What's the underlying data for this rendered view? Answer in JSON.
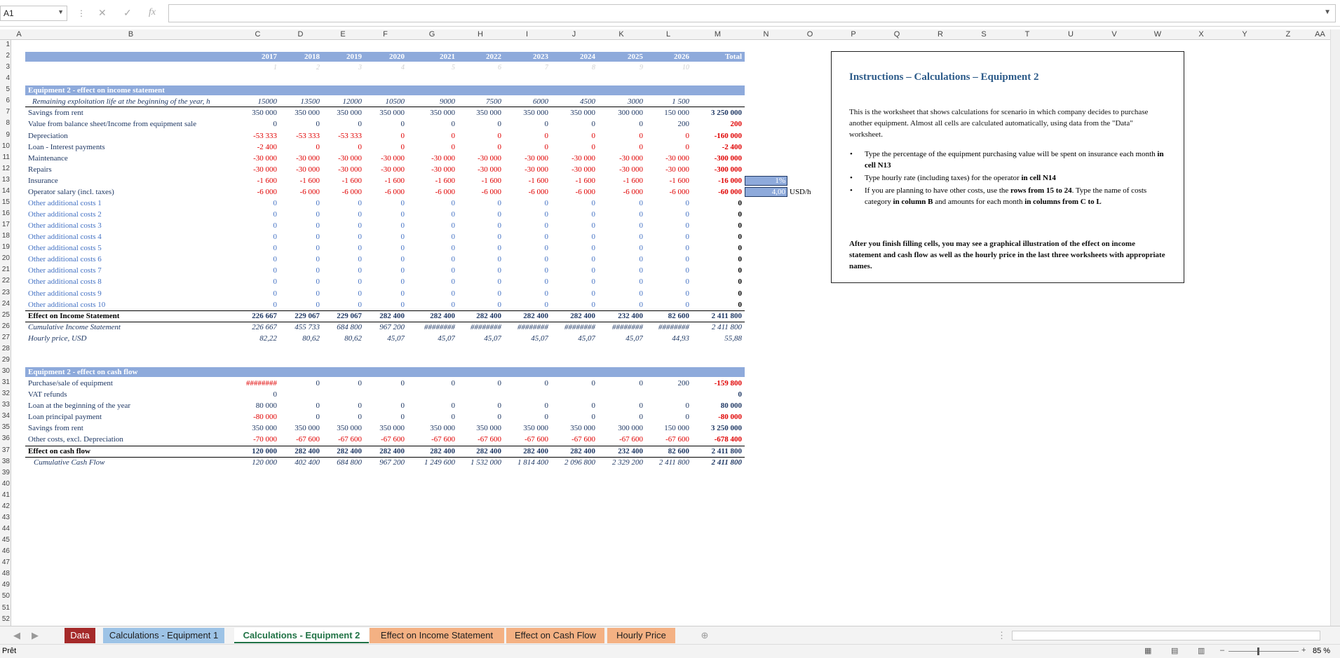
{
  "formula_bar": {
    "name_box": "A1",
    "fx": "fx"
  },
  "columns": [
    "A",
    "B",
    "C",
    "D",
    "E",
    "F",
    "G",
    "H",
    "I",
    "J",
    "K",
    "L",
    "M",
    "N",
    "O",
    "P",
    "Q",
    "R",
    "S",
    "T",
    "U",
    "V",
    "W",
    "X",
    "Y",
    "Z",
    "AA"
  ],
  "rows": [
    "1",
    "2",
    "3",
    "4",
    "5",
    "6",
    "7",
    "8",
    "9",
    "10",
    "11",
    "12",
    "13",
    "14",
    "15",
    "16",
    "17",
    "18",
    "19",
    "20",
    "21",
    "22",
    "23",
    "24",
    "25",
    "26",
    "27",
    "28",
    "29",
    "30",
    "31",
    "32",
    "33",
    "34",
    "35",
    "36",
    "37",
    "38",
    "39",
    "40",
    "41",
    "42",
    "43",
    "44",
    "45",
    "46",
    "47",
    "48",
    "49",
    "50",
    "51",
    "52"
  ],
  "years": [
    "2017",
    "2018",
    "2019",
    "2020",
    "2021",
    "2022",
    "2023",
    "2024",
    "2025",
    "2026",
    "Total"
  ],
  "year_idx": [
    "1",
    "2",
    "3",
    "4",
    "5",
    "6",
    "7",
    "8",
    "9",
    "10"
  ],
  "income": {
    "title": "Equipment 2 - effect on income statement",
    "rows": [
      {
        "label": "Remaining exploitation life at the beginning of the year, h",
        "style": "ital",
        "vals": [
          "15000",
          "13500",
          "12000",
          "10500",
          "9000",
          "7500",
          "6000",
          "4500",
          "3000",
          "1 500",
          ""
        ]
      },
      {
        "label": "Savings from rent",
        "style": "",
        "vals": [
          "350 000",
          "350 000",
          "350 000",
          "350 000",
          "350 000",
          "350 000",
          "350 000",
          "350 000",
          "300 000",
          "150 000",
          "3 250 000"
        ]
      },
      {
        "label": "Value from balance sheet/Income from equipment sale",
        "style": "",
        "vals": [
          "0",
          "0",
          "0",
          "0",
          "0",
          "0",
          "0",
          "0",
          "0",
          "200",
          "200"
        ]
      },
      {
        "label": "Depreciation",
        "style": "neg",
        "vals": [
          "-53 333",
          "-53 333",
          "-53 333",
          "0",
          "0",
          "0",
          "0",
          "0",
          "0",
          "0",
          "-160 000"
        ]
      },
      {
        "label": "Loan - Interest payments",
        "style": "neg",
        "vals": [
          "-2 400",
          "0",
          "0",
          "0",
          "0",
          "0",
          "0",
          "0",
          "0",
          "0",
          "-2 400"
        ]
      },
      {
        "label": "Maintenance",
        "style": "neg",
        "vals": [
          "-30 000",
          "-30 000",
          "-30 000",
          "-30 000",
          "-30 000",
          "-30 000",
          "-30 000",
          "-30 000",
          "-30 000",
          "-30 000",
          "-300 000"
        ]
      },
      {
        "label": "Repairs",
        "style": "neg",
        "vals": [
          "-30 000",
          "-30 000",
          "-30 000",
          "-30 000",
          "-30 000",
          "-30 000",
          "-30 000",
          "-30 000",
          "-30 000",
          "-30 000",
          "-300 000"
        ]
      },
      {
        "label": "Insurance",
        "style": "neg",
        "vals": [
          "-1 600",
          "-1 600",
          "-1 600",
          "-1 600",
          "-1 600",
          "-1 600",
          "-1 600",
          "-1 600",
          "-1 600",
          "-1 600",
          "-16 000"
        ]
      },
      {
        "label": "Operator salary (incl. taxes)",
        "style": "neg",
        "vals": [
          "-6 000",
          "-6 000",
          "-6 000",
          "-6 000",
          "-6 000",
          "-6 000",
          "-6 000",
          "-6 000",
          "-6 000",
          "-6 000",
          "-60 000"
        ]
      },
      {
        "label": "Other additional costs 1",
        "style": "blue",
        "vals": [
          "0",
          "0",
          "0",
          "0",
          "0",
          "0",
          "0",
          "0",
          "0",
          "0",
          "0"
        ]
      },
      {
        "label": "Other additional costs 2",
        "style": "blue",
        "vals": [
          "0",
          "0",
          "0",
          "0",
          "0",
          "0",
          "0",
          "0",
          "0",
          "0",
          "0"
        ]
      },
      {
        "label": "Other additional costs 3",
        "style": "blue",
        "vals": [
          "0",
          "0",
          "0",
          "0",
          "0",
          "0",
          "0",
          "0",
          "0",
          "0",
          "0"
        ]
      },
      {
        "label": "Other additional costs 4",
        "style": "blue",
        "vals": [
          "0",
          "0",
          "0",
          "0",
          "0",
          "0",
          "0",
          "0",
          "0",
          "0",
          "0"
        ]
      },
      {
        "label": "Other additional costs 5",
        "style": "blue",
        "vals": [
          "0",
          "0",
          "0",
          "0",
          "0",
          "0",
          "0",
          "0",
          "0",
          "0",
          "0"
        ]
      },
      {
        "label": "Other additional costs 6",
        "style": "blue",
        "vals": [
          "0",
          "0",
          "0",
          "0",
          "0",
          "0",
          "0",
          "0",
          "0",
          "0",
          "0"
        ]
      },
      {
        "label": "Other additional costs 7",
        "style": "blue",
        "vals": [
          "0",
          "0",
          "0",
          "0",
          "0",
          "0",
          "0",
          "0",
          "0",
          "0",
          "0"
        ]
      },
      {
        "label": "Other additional costs 8",
        "style": "blue",
        "vals": [
          "0",
          "0",
          "0",
          "0",
          "0",
          "0",
          "0",
          "0",
          "0",
          "0",
          "0"
        ]
      },
      {
        "label": "Other additional costs 9",
        "style": "blue",
        "vals": [
          "0",
          "0",
          "0",
          "0",
          "0",
          "0",
          "0",
          "0",
          "0",
          "0",
          "0"
        ]
      },
      {
        "label": "Other additional costs 10",
        "style": "blue",
        "vals": [
          "0",
          "0",
          "0",
          "0",
          "0",
          "0",
          "0",
          "0",
          "0",
          "0",
          "0"
        ]
      },
      {
        "label": "Effect on Income Statement",
        "style": "bold",
        "vals": [
          "226 667",
          "229 067",
          "229 067",
          "282 400",
          "282 400",
          "282 400",
          "282 400",
          "282 400",
          "232 400",
          "82 600",
          "2 411 800"
        ]
      },
      {
        "label": "Cumulative Income Statement",
        "style": "ital",
        "vals": [
          "226 667",
          "455 733",
          "684 800",
          "967 200",
          "########",
          "########",
          "########",
          "########",
          "########",
          "########",
          "2 411 800"
        ]
      },
      {
        "label": "Hourly price, USD",
        "style": "ital",
        "vals": [
          "82,22",
          "80,62",
          "80,62",
          "45,07",
          "45,07",
          "45,07",
          "45,07",
          "45,07",
          "45,07",
          "44,93",
          "55,88"
        ]
      }
    ],
    "insurance_input": "1%",
    "hourly_input": "4,00",
    "hourly_unit": "USD/h"
  },
  "cash": {
    "title": "Equipment 2 - effect on cash flow",
    "rows": [
      {
        "label": "Purchase/sale of equipment",
        "style": "",
        "vals": [
          "########",
          "0",
          "0",
          "0",
          "0",
          "0",
          "0",
          "0",
          "0",
          "200",
          "-159 800"
        ]
      },
      {
        "label": "VAT refunds",
        "style": "",
        "vals": [
          "0",
          "",
          "",
          "",
          "",
          "",
          "",
          "",
          "",
          "",
          "0"
        ]
      },
      {
        "label": "Loan at the beginning of the year",
        "style": "",
        "vals": [
          "80 000",
          "0",
          "0",
          "0",
          "0",
          "0",
          "0",
          "0",
          "0",
          "0",
          "80 000"
        ]
      },
      {
        "label": "Loan principal payment",
        "style": "",
        "vals": [
          "-80 000",
          "0",
          "0",
          "0",
          "0",
          "0",
          "0",
          "0",
          "0",
          "0",
          "-80 000"
        ]
      },
      {
        "label": "Savings from rent",
        "style": "",
        "vals": [
          "350 000",
          "350 000",
          "350 000",
          "350 000",
          "350 000",
          "350 000",
          "350 000",
          "350 000",
          "300 000",
          "150 000",
          "3 250 000"
        ]
      },
      {
        "label": "Other costs, excl. Depreciation",
        "style": "neg",
        "vals": [
          "-70 000",
          "-67 600",
          "-67 600",
          "-67 600",
          "-67 600",
          "-67 600",
          "-67 600",
          "-67 600",
          "-67 600",
          "-67 600",
          "-678 400"
        ]
      },
      {
        "label": "Effect on cash flow",
        "style": "bold",
        "vals": [
          "120 000",
          "282 400",
          "282 400",
          "282 400",
          "282 400",
          "282 400",
          "282 400",
          "282 400",
          "232 400",
          "82 600",
          "2 411 800"
        ]
      },
      {
        "label": "Cumulative Cash Flow",
        "style": "ital",
        "vals": [
          "120 000",
          "402 400",
          "684 800",
          "967 200",
          "1 249 600",
          "1 532 000",
          "1 814 400",
          "2 096 800",
          "2 329 200",
          "2 411 800",
          "2 411 800"
        ]
      }
    ]
  },
  "instructions": {
    "title": "Instructions – Calculations – Equipment 2",
    "intro": "This is the worksheet that shows calculations for scenario in which company decides to purchase another equipment. Almost all cells are calculated automatically, using data from the \"Data\" worksheet.",
    "b1_text": "Type the percentage of the equipment purchasing value will be spent on insurance each month ",
    "b1_bold": "in cell N13",
    "b2_text": "Type hourly rate (including taxes) for the operator ",
    "b2_bold": "in cell N14",
    "b3_a": "If you are planning to have other costs, use the ",
    "b3_b": "rows from 15 to 24",
    "b3_c": ". Type the name of costs category ",
    "b3_d": "in column B",
    "b3_e": " and amounts for each month ",
    "b3_f": "in columns from C to L",
    "outro": "After you finish filling cells, you may see a graphical illustration of the effect on income statement and cash flow as well as the hourly price in the last three worksheets with appropriate names."
  },
  "tabs": [
    {
      "label": "Data",
      "bg": "#a52a2a",
      "fg": "#ffffff"
    },
    {
      "label": "Calculations - Equipment 1",
      "bg": "#9dc3e6",
      "fg": "#1f1f1f"
    },
    {
      "label": "Calculations - Equipment 2",
      "bg": "#ffffff",
      "fg": "#217346"
    },
    {
      "label": "Effect on Income Statement",
      "bg": "#f4b183",
      "fg": "#1f1f1f"
    },
    {
      "label": "Effect on Cash Flow",
      "bg": "#f4b183",
      "fg": "#1f1f1f"
    },
    {
      "label": "Hourly Price",
      "bg": "#f4b183",
      "fg": "#1f1f1f"
    }
  ],
  "status": {
    "ready": "Prêt",
    "zoom": "85 %"
  }
}
